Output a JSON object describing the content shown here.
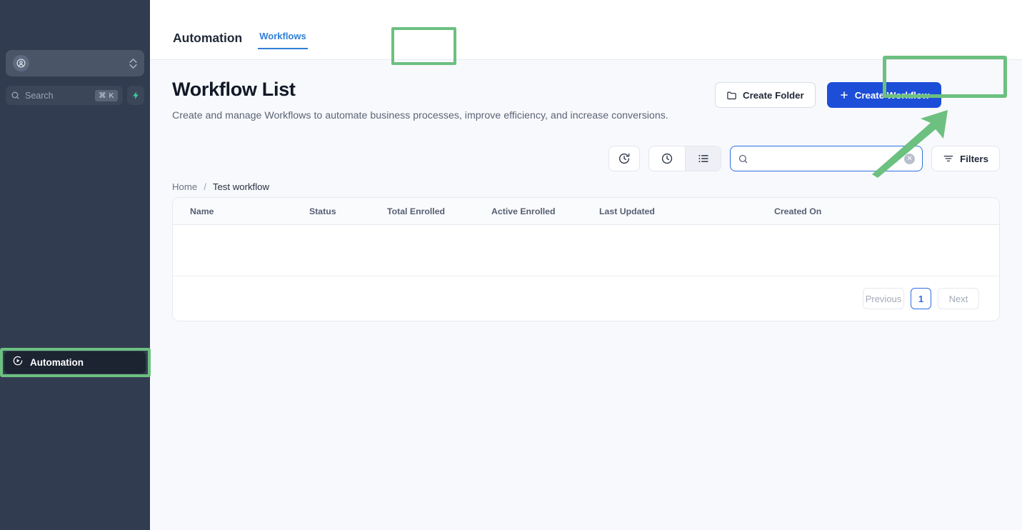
{
  "sidebar": {
    "account_switcher": {
      "name": "account-switcher",
      "avatar_icon": "user-circle-icon"
    },
    "search": {
      "placeholder": "Search",
      "shortcut": "⌘ K",
      "icon": "search-icon",
      "bolt_icon": "lightning-bolt-icon"
    },
    "nav": {
      "automation_label": "Automation",
      "automation_icon": "play-circle-icon"
    }
  },
  "topbar": {
    "page_label": "Automation",
    "tab_label": "Workflows"
  },
  "header": {
    "title": "Workflow List",
    "subtitle": "Create and manage Workflows to automate business processes, improve efficiency, and increase conversions.",
    "create_folder_label": "Create Folder",
    "create_folder_icon": "folder-icon",
    "create_workflow_label": "Create Workflow",
    "create_workflow_icon": "plus-icon"
  },
  "toolbar": {
    "history_icon": "clock-rotate-icon",
    "clock_icon": "clock-icon",
    "list_icon": "list-view-icon",
    "search_placeholder": "",
    "search_value": "",
    "search_icon": "search-icon",
    "clear_icon": "clear-circle-icon",
    "filters_label": "Filters",
    "filters_icon": "filter-icon"
  },
  "breadcrumb": {
    "home": "Home",
    "separator": "/",
    "current": "Test workflow"
  },
  "table": {
    "columns": [
      "Name",
      "Status",
      "Total Enrolled",
      "Active Enrolled",
      "Last Updated",
      "Created On"
    ],
    "rows": []
  },
  "pagination": {
    "previous": "Previous",
    "page": "1",
    "next": "Next"
  },
  "colors": {
    "annotation_green": "#6cc080",
    "primary_blue": "#1d4ed8",
    "tab_blue": "#2f7fd6",
    "sidebar_bg": "#323c50",
    "page_bg": "#f8f9fc"
  }
}
